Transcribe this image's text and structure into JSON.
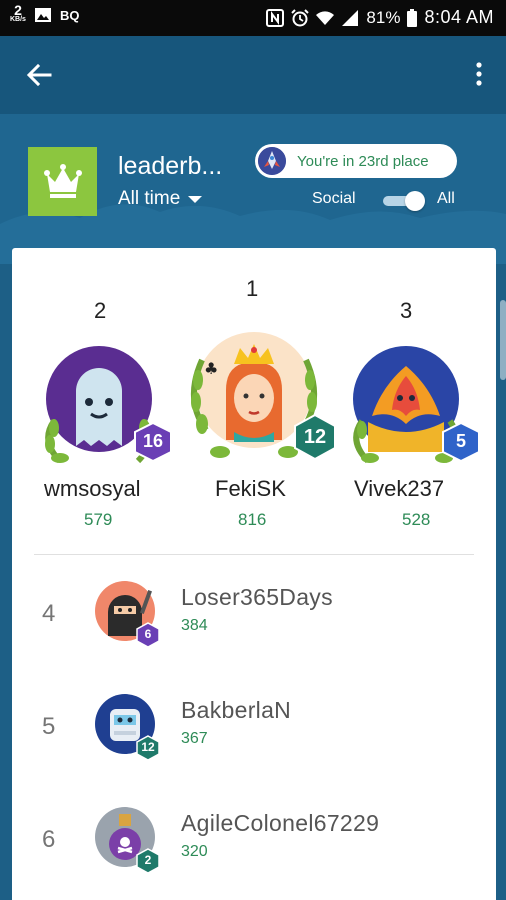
{
  "status_bar": {
    "kbs_value": "2",
    "kbs_unit": "KB/s",
    "carrier": "BQ",
    "battery": "81%",
    "time": "8:04 AM"
  },
  "app_bar": {
    "back_icon": "arrow-left-icon",
    "menu_icon": "more-vertical-icon"
  },
  "header": {
    "title": "leaderb...",
    "period": "All time",
    "place_text": "You're in 23rd place",
    "toggle_left": "Social",
    "toggle_right": "All",
    "toggle_on": true,
    "accent": "#8cc63f"
  },
  "podium": [
    {
      "rank": "2",
      "name": "wmsosyal",
      "score": "579",
      "level": "16",
      "badge_color": "#6a3fb5"
    },
    {
      "rank": "1",
      "name": "FekiSK",
      "score": "816",
      "level": "12",
      "badge_color": "#1f7a6a"
    },
    {
      "rank": "3",
      "name": "Vivek237",
      "score": "528",
      "level": "5",
      "badge_color": "#2f63c9"
    }
  ],
  "list": [
    {
      "rank": "4",
      "name": "Loser365Days",
      "score": "384",
      "level": "6",
      "badge_color": "#6a3fb5"
    },
    {
      "rank": "5",
      "name": "BakberlaN",
      "score": "367",
      "level": "12",
      "badge_color": "#1f7a6a"
    },
    {
      "rank": "6",
      "name": "AgileColonel67229",
      "score": "320",
      "level": "2",
      "badge_color": "#1f7a6a"
    }
  ],
  "colors": {
    "score_green": "#2e8b57",
    "app_bar": "#17567c"
  }
}
